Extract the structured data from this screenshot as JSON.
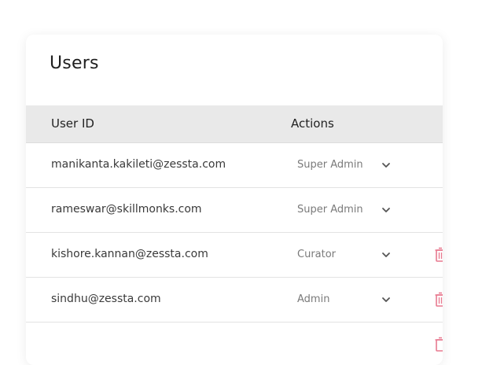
{
  "users_card": {
    "title": "Users"
  },
  "table": {
    "columns": [
      "User ID",
      "Actions"
    ],
    "rows": [
      {
        "user_id": "manikanta.kakileti@zessta.com",
        "role": "Super Admin",
        "deletable": false
      },
      {
        "user_id": "rameswar@skillmonks.com",
        "role": "Super Admin",
        "deletable": false
      },
      {
        "user_id": "kishore.kannan@zessta.com",
        "role": "Curator",
        "deletable": true
      },
      {
        "user_id": "sindhu@zessta.com",
        "role": "Admin",
        "deletable": true
      },
      {
        "user_id": "",
        "role": "",
        "deletable": true
      }
    ]
  },
  "colors": {
    "header_bg": "#e9e9e9",
    "delete_icon": "#e8798f",
    "chevron": "#555555"
  },
  "icons": {
    "dropdown": "chevron-down-icon",
    "delete": "trash-icon"
  }
}
